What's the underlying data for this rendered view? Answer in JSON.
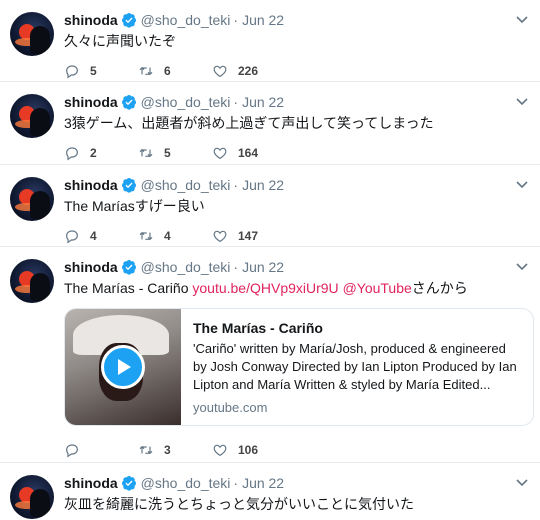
{
  "colors": {
    "accent": "#1da1f2",
    "link": "#e0245e",
    "muted": "#657786",
    "text": "#14171a"
  },
  "tweets": [
    {
      "name": "shinoda",
      "handle": "@sho_do_teki",
      "dot": "·",
      "date": "Jun 22",
      "text": "久々に声聞いたぞ",
      "reply_count": "5",
      "retweet_count": "6",
      "like_count": "226"
    },
    {
      "name": "shinoda",
      "handle": "@sho_do_teki",
      "dot": "·",
      "date": "Jun 22",
      "text": "3猿ゲーム、出題者が斜め上過ぎて声出して笑ってしまった",
      "reply_count": "2",
      "retweet_count": "5",
      "like_count": "164"
    },
    {
      "name": "shinoda",
      "handle": "@sho_do_teki",
      "dot": "·",
      "date": "Jun 22",
      "text": "The Maríasすげー良い",
      "reply_count": "4",
      "retweet_count": "4",
      "like_count": "147"
    },
    {
      "name": "shinoda",
      "handle": "@sho_do_teki",
      "dot": "·",
      "date": "Jun 22",
      "text_prefix": "The Marías - Cariño ",
      "text_link": "youtu.be/QHVp9xiUr9U",
      "text_mention": "@YouTube",
      "text_suffix": "さんから",
      "card": {
        "title": "The Marías - Cariño",
        "desc_1": "'Cariño' written by María/Josh, produced & engineered",
        "desc_2": "by Josh Conway Directed by Ian Lipton Produced by Ian",
        "desc_3": "Lipton and María Written & styled by María Edited...",
        "domain": "youtube.com"
      },
      "reply_count": "",
      "retweet_count": "3",
      "like_count": "106"
    },
    {
      "name": "shinoda",
      "handle": "@sho_do_teki",
      "dot": "·",
      "date": "Jun 22",
      "text": "灰皿を綺麗に洗うとちょっと気分がいいことに気付いた"
    }
  ]
}
